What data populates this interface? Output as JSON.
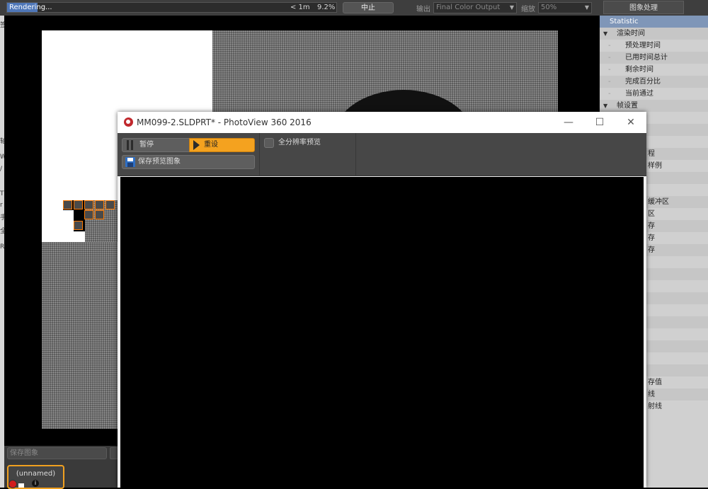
{
  "topbar": {
    "status": "Rendering...",
    "progress_percent": 9.2,
    "time_left": "< 1m",
    "percent_text": "9.2%",
    "stop_label": "中止",
    "output_label": "输出",
    "output_value": "Final Color Output",
    "zoom_label": "缩放",
    "zoom_value": "50%",
    "image_processing_tab": "图象处理"
  },
  "left_edge": {
    "chars": [
      "签",
      "轴",
      "W",
      "/",
      "T",
      "r",
      "手",
      "全",
      "R"
    ]
  },
  "statistics": {
    "header": "Statistic",
    "rows": [
      {
        "label": "渲染时间",
        "type": "group"
      },
      {
        "label": "预处理时间",
        "type": "item"
      },
      {
        "label": "已用时间总计",
        "type": "item"
      },
      {
        "label": "剩余时间",
        "type": "item"
      },
      {
        "label": "完成百分比",
        "type": "item"
      },
      {
        "label": "当前通过",
        "type": "item"
      },
      {
        "label": "帧设置",
        "type": "group"
      },
      {
        "label": "",
        "type": "blank"
      },
      {
        "label": "",
        "type": "blank"
      },
      {
        "label": "",
        "type": "blank"
      },
      {
        "label": "程",
        "type": "partial"
      },
      {
        "label": "样例",
        "type": "partial"
      },
      {
        "label": "",
        "type": "blank"
      },
      {
        "label": "",
        "type": "blank"
      },
      {
        "label": "缓冲区",
        "type": "partial"
      },
      {
        "label": "区",
        "type": "partial"
      },
      {
        "label": "存",
        "type": "partial"
      },
      {
        "label": "存",
        "type": "partial"
      },
      {
        "label": "存",
        "type": "partial"
      },
      {
        "label": "",
        "type": "blank"
      },
      {
        "label": "",
        "type": "blank"
      },
      {
        "label": "",
        "type": "blank"
      },
      {
        "label": "",
        "type": "blank"
      },
      {
        "label": "",
        "type": "blank"
      },
      {
        "label": "",
        "type": "blank"
      },
      {
        "label": "",
        "type": "blank"
      },
      {
        "label": "",
        "type": "blank"
      },
      {
        "label": "",
        "type": "blank"
      },
      {
        "label": "",
        "type": "blank"
      },
      {
        "label": "存值",
        "type": "partial"
      },
      {
        "label": "线",
        "type": "partial"
      },
      {
        "label": "射线",
        "type": "partial"
      }
    ]
  },
  "bottom": {
    "save_image_placeholder": "保存图象",
    "preset_name": "(unnamed)",
    "info_glyph": "i"
  },
  "dialog": {
    "title": "MM099-2.SLDPRT* - PhotoView 360 2016",
    "minimize_glyph": "—",
    "maximize_glyph": "☐",
    "close_glyph": "✕",
    "pause_label": "暂停",
    "reset_label": "重设",
    "save_preview_label": "保存预览图象",
    "fullres_label": "全分辨率预览",
    "fullres_checked": false
  },
  "colors": {
    "accent_orange": "#f4a21f",
    "progress_blue": "#4f77b8",
    "tile_outline": "#ff7a00",
    "stat_header": "#7f96b8"
  },
  "icons": [
    "pause-icon",
    "play-icon",
    "floppy-disk-icon",
    "photoview-logo-icon",
    "dropdown-arrow-icon",
    "info-icon"
  ]
}
